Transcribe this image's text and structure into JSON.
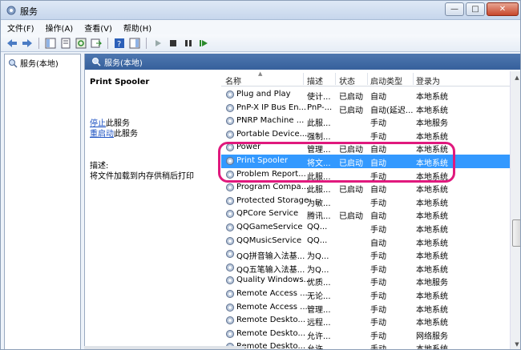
{
  "window": {
    "title": "服务",
    "min": "—",
    "max": "□",
    "close": "✕"
  },
  "menu": [
    "文件(F)",
    "操作(A)",
    "查看(V)",
    "帮助(H)"
  ],
  "left": {
    "tree_item": "服务(本地)"
  },
  "header": {
    "title": "服务(本地)"
  },
  "detail": {
    "service_name": "Print Spooler",
    "stop_link": "停止",
    "stop_suffix": "此服务",
    "restart_link": "重启动",
    "restart_suffix": "此服务",
    "desc_label": "描述:",
    "desc_text": "将文件加载到内存供稍后打印"
  },
  "columns": [
    "名称",
    "描述",
    "状态",
    "启动类型",
    "登录为"
  ],
  "rows": [
    {
      "name": "Plug and Play",
      "desc": "使计...",
      "status": "已启动",
      "startup": "自动",
      "logon": "本地系统"
    },
    {
      "name": "PnP-X IP Bus En...",
      "desc": "PnP-...",
      "status": "已启动",
      "startup": "自动(延迟...",
      "logon": "本地系统"
    },
    {
      "name": "PNRP Machine ...",
      "desc": "此服...",
      "status": "",
      "startup": "手动",
      "logon": "本地服务"
    },
    {
      "name": "Portable Device...",
      "desc": "强制...",
      "status": "",
      "startup": "手动",
      "logon": "本地系统"
    },
    {
      "name": "Power",
      "desc": "管理...",
      "status": "已启动",
      "startup": "自动",
      "logon": "本地系统"
    },
    {
      "name": "Print Spooler",
      "desc": "将文...",
      "status": "已启动",
      "startup": "自动",
      "logon": "本地系统",
      "selected": true
    },
    {
      "name": "Problem Report...",
      "desc": "此服...",
      "status": "",
      "startup": "手动",
      "logon": "本地系统"
    },
    {
      "name": "Program Compa...",
      "desc": "此服...",
      "status": "已启动",
      "startup": "自动",
      "logon": "本地系统"
    },
    {
      "name": "Protected Storage",
      "desc": "为敏...",
      "status": "",
      "startup": "手动",
      "logon": "本地系统"
    },
    {
      "name": "QPCore Service",
      "desc": "腾讯...",
      "status": "已启动",
      "startup": "自动",
      "logon": "本地系统"
    },
    {
      "name": "QQGameService",
      "desc": "QQ...",
      "status": "",
      "startup": "手动",
      "logon": "本地系统"
    },
    {
      "name": "QQMusicService",
      "desc": "QQ...",
      "status": "",
      "startup": "自动",
      "logon": "本地系统"
    },
    {
      "name": "QQ拼音输入法基...",
      "desc": "为Q...",
      "status": "",
      "startup": "手动",
      "logon": "本地系统"
    },
    {
      "name": "QQ五笔输入法基...",
      "desc": "为Q...",
      "status": "",
      "startup": "手动",
      "logon": "本地系统"
    },
    {
      "name": "Quality Windows...",
      "desc": "优质...",
      "status": "",
      "startup": "手动",
      "logon": "本地服务"
    },
    {
      "name": "Remote Access ...",
      "desc": "无论...",
      "status": "",
      "startup": "手动",
      "logon": "本地系统"
    },
    {
      "name": "Remote Access ...",
      "desc": "管理...",
      "status": "",
      "startup": "手动",
      "logon": "本地系统"
    },
    {
      "name": "Remote Deskto...",
      "desc": "远程...",
      "status": "",
      "startup": "手动",
      "logon": "本地系统"
    },
    {
      "name": "Remote Deskto...",
      "desc": "允许...",
      "status": "",
      "startup": "手动",
      "logon": "网络服务"
    },
    {
      "name": "Remote Deskto...",
      "desc": "允许...",
      "status": "",
      "startup": "手动",
      "logon": "本地系统"
    }
  ]
}
